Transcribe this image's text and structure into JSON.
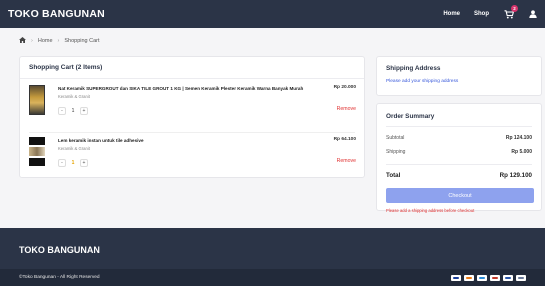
{
  "header": {
    "brand": "TOKO BANGUNAN",
    "nav": [
      "Home",
      "Shop"
    ],
    "cart_count": "2"
  },
  "breadcrumb": [
    "Home",
    "Shopping Cart"
  ],
  "cart": {
    "title": "Shopping Cart (2 Items)",
    "items": [
      {
        "name": "Nat Keramik SUPERGROUT dan SIKA TILE GROUT 1 KG | Semen Keramik Plester Keramik Warna Banyak Murah",
        "category": "Keramik & Granit",
        "quantity": "1",
        "price": "Rp 20.000",
        "remove_label": "Remove"
      },
      {
        "name": "Lem keramik instan untuk tile adhesive",
        "category": "Keramik & Granit",
        "quantity": "1",
        "price": "Rp 64.100",
        "remove_label": "Remove"
      }
    ],
    "qty_minus": "-",
    "qty_plus": "+"
  },
  "shipping": {
    "title": "Shipping Address",
    "link": "Please add your shipping address"
  },
  "summary": {
    "title": "Order Summary",
    "subtotal_label": "Subtotal",
    "subtotal_value": "Rp 124.100",
    "shipping_label": "Shipping",
    "shipping_value": "Rp 5.000",
    "total_label": "Total",
    "total_value": "Rp 129.100",
    "checkout_label": "Checkout",
    "warning": "Please add a shipping address before checkout"
  },
  "footer": {
    "brand": "TOKO BANGUNAN",
    "copyright": "©Toko Bangunan - All Right Reserved",
    "payment_icons": [
      "visa-icon",
      "mastercard-icon",
      "amex-icon",
      "bank-icon",
      "bank-icon",
      "bank-icon"
    ]
  },
  "colors": {
    "header_bg": "#2b3447",
    "accent": "#3b5bdb",
    "checkout": "#8ea2ee",
    "danger": "#e03131",
    "badge": "#d6336c"
  }
}
